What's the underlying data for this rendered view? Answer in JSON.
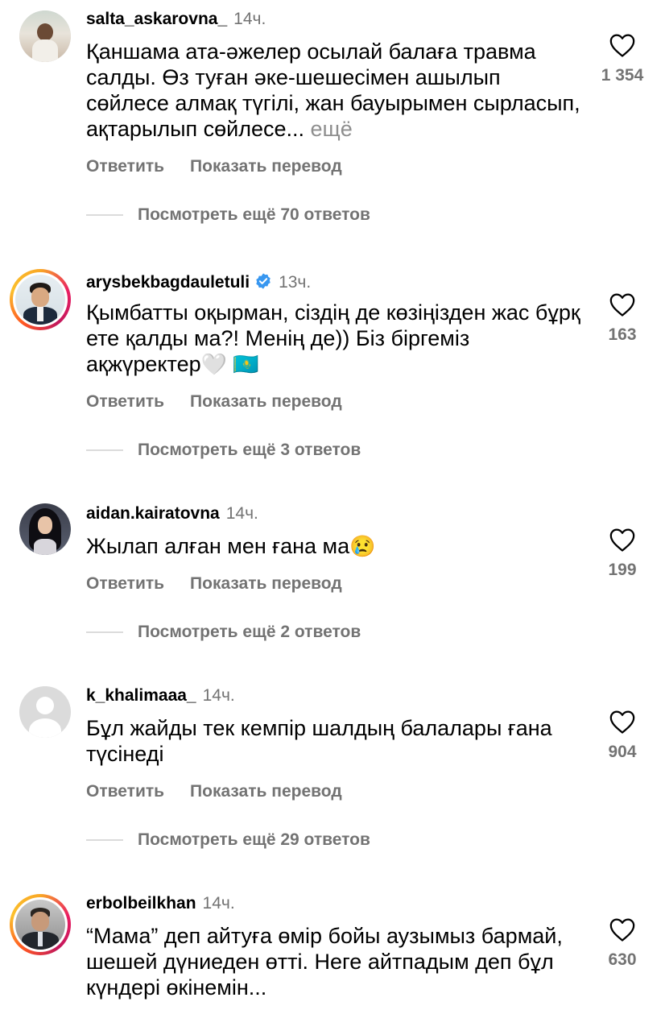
{
  "comments": [
    {
      "username": "salta_askarovna_",
      "time": "14ч.",
      "text": "Қаншама ата-әжелер осылай балаға травма салды. Өз туған әке-шешесімен ашылып сөйлесе алмақ түгілі, жан бауырымен сырласып, ақтарылып сөйлесе...",
      "more": "ещё",
      "reply_label": "Ответить",
      "translate_label": "Показать перевод",
      "view_replies": "Посмотреть ещё 70 ответов",
      "likes": "1 354"
    },
    {
      "username": "arysbekbagdauletuli",
      "time": "13ч.",
      "text": "Қымбатты оқырман, сіздің де көзіңізден жас бұрқ ете қалды ма?! Менің де)) Біз біргеміз ақжүректер",
      "emoji": "🤍 🇰🇿",
      "reply_label": "Ответить",
      "translate_label": "Показать перевод",
      "view_replies": "Посмотреть ещё 3 ответов",
      "likes": "163"
    },
    {
      "username": "aidan.kairatovna",
      "time": "14ч.",
      "text": "Жылап алған мен ғана ма",
      "emoji": "😢",
      "reply_label": "Ответить",
      "translate_label": "Показать перевод",
      "view_replies": "Посмотреть ещё 2 ответов",
      "likes": "199"
    },
    {
      "username": "k_khalimaaa_",
      "time": "14ч.",
      "text": "Бұл жайды тек кемпір шалдың балалары ғана түсінеді",
      "reply_label": "Ответить",
      "translate_label": "Показать перевод",
      "view_replies": "Посмотреть ещё 29 ответов",
      "likes": "904"
    },
    {
      "username": "erbolbeilkhan",
      "time": "14ч.",
      "text": "“Мама” деп айтуға өмір бойы аузымыз бармай, шешей дүниеден өтті. Неге айтпадым деп бұл күндері өкінемін...",
      "likes": "630"
    }
  ],
  "colors": {
    "secondary": "#737373",
    "verified": "#3897f0",
    "divider": "#dbdbdb"
  },
  "icons": {
    "like": "heart-outline-icon",
    "verified": "verified-badge-icon",
    "default_avatar": "default-avatar-icon"
  }
}
